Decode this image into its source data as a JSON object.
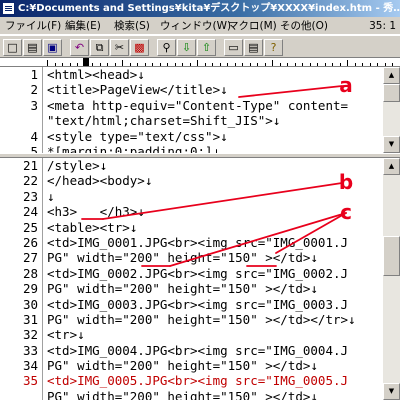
{
  "window": {
    "title": "C:¥Documents and Settings¥kita¥デスクトップ¥XXXX¥index.htm - 秀…"
  },
  "menu": {
    "items": [
      "ファイル(F)",
      "編集(E)",
      "検索(S)",
      "ウィンドウ(W)",
      "マクロ(M)",
      "その他(O)"
    ],
    "position": "35: 1"
  },
  "toolbar": {
    "buttons": [
      "new-file",
      "open-file",
      "save-file",
      "undo",
      "copy",
      "cut",
      "paste",
      "find",
      "find-next",
      "find-previous",
      "window",
      "split",
      "help"
    ]
  },
  "editor": {
    "top_pane": [
      {
        "num": "1",
        "text": "<html><head>↓"
      },
      {
        "num": "2",
        "text": "<title>PageView</title>↓"
      },
      {
        "num": "3",
        "text": "<meta http-equiv=\"Content-Type\" content="
      },
      {
        "num": "",
        "text": "\"text/html;charset=Shift_JIS\">↓"
      },
      {
        "num": "4",
        "text": "<style type=\"text/css\">↓"
      },
      {
        "num": "5",
        "text": "*[margin:0;padding:0;]↓"
      }
    ],
    "bottom_pane": [
      {
        "num": "21",
        "text": "/style>↓"
      },
      {
        "num": "22",
        "text": "</head><body>↓"
      },
      {
        "num": "23",
        "text": "↓"
      },
      {
        "num": "24",
        "text": "<h3>   </h3>↓"
      },
      {
        "num": "25",
        "text": "<table><tr>↓"
      },
      {
        "num": "26",
        "text": "<td>IMG_0001.JPG<br><img src=\"IMG_0001.J"
      },
      {
        "num": "27",
        "text": "PG\" width=\"200\" height=\"150\" ></td>↓"
      },
      {
        "num": "28",
        "text": "<td>IMG_0002.JPG<br><img src=\"IMG_0002.J"
      },
      {
        "num": "29",
        "text": "PG\" width=\"200\" height=\"150\" ></td>↓"
      },
      {
        "num": "30",
        "text": "<td>IMG_0003.JPG<br><img src=\"IMG_0003.J"
      },
      {
        "num": "31",
        "text": "PG\" width=\"200\" height=\"150\" ></td></tr>↓"
      },
      {
        "num": "32",
        "text": "<tr>↓"
      },
      {
        "num": "33",
        "text": "<td>IMG_0004.JPG<br><img src=\"IMG_0004.J"
      },
      {
        "num": "34",
        "text": "PG\" width=\"200\" height=\"150\" ></td>↓"
      },
      {
        "num": "35",
        "text": "<td>IMG_0005.JPG<br><img src=\"IMG_0005.J",
        "current": true
      },
      {
        "num": "",
        "text": "PG\" width=\"200\" height=\"150\" ></td>↓"
      }
    ]
  },
  "annotations": {
    "color": "#e8001c",
    "labels": [
      "a",
      "b",
      "c"
    ]
  },
  "colors": {
    "title_bar": "#0a246a",
    "current_line": "#c00000",
    "annotation": "#e8001c"
  }
}
